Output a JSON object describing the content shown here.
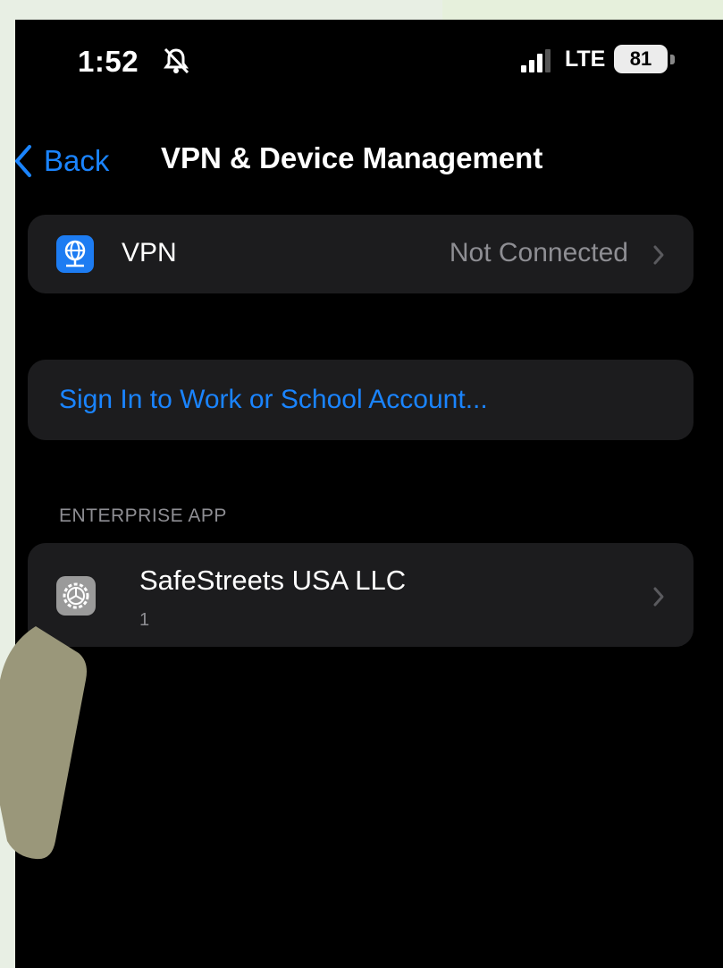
{
  "status_bar": {
    "time": "1:52",
    "network": "LTE",
    "battery_level": "81",
    "icons": [
      "bell-slash-icon",
      "signal-bars-icon",
      "battery-icon"
    ]
  },
  "nav": {
    "back_label": "Back",
    "title": "VPN & Device Management"
  },
  "vpn_row": {
    "label": "VPN",
    "value": "Not Connected",
    "icon": "vpn-globe-icon",
    "icon_color": "#1d7cf2"
  },
  "signin_row": {
    "label": "Sign In to Work or School Account..."
  },
  "enterprise_section": {
    "header": "ENTERPRISE APP",
    "app_name": "SafeStreets USA LLC",
    "app_count": "1",
    "icon": "settings-gear-icon"
  },
  "colors": {
    "accent": "#1a84ff",
    "cell_background": "#1c1c1e",
    "secondary_text": "#8e8e93",
    "overlay_arrow": "#9a977a"
  }
}
